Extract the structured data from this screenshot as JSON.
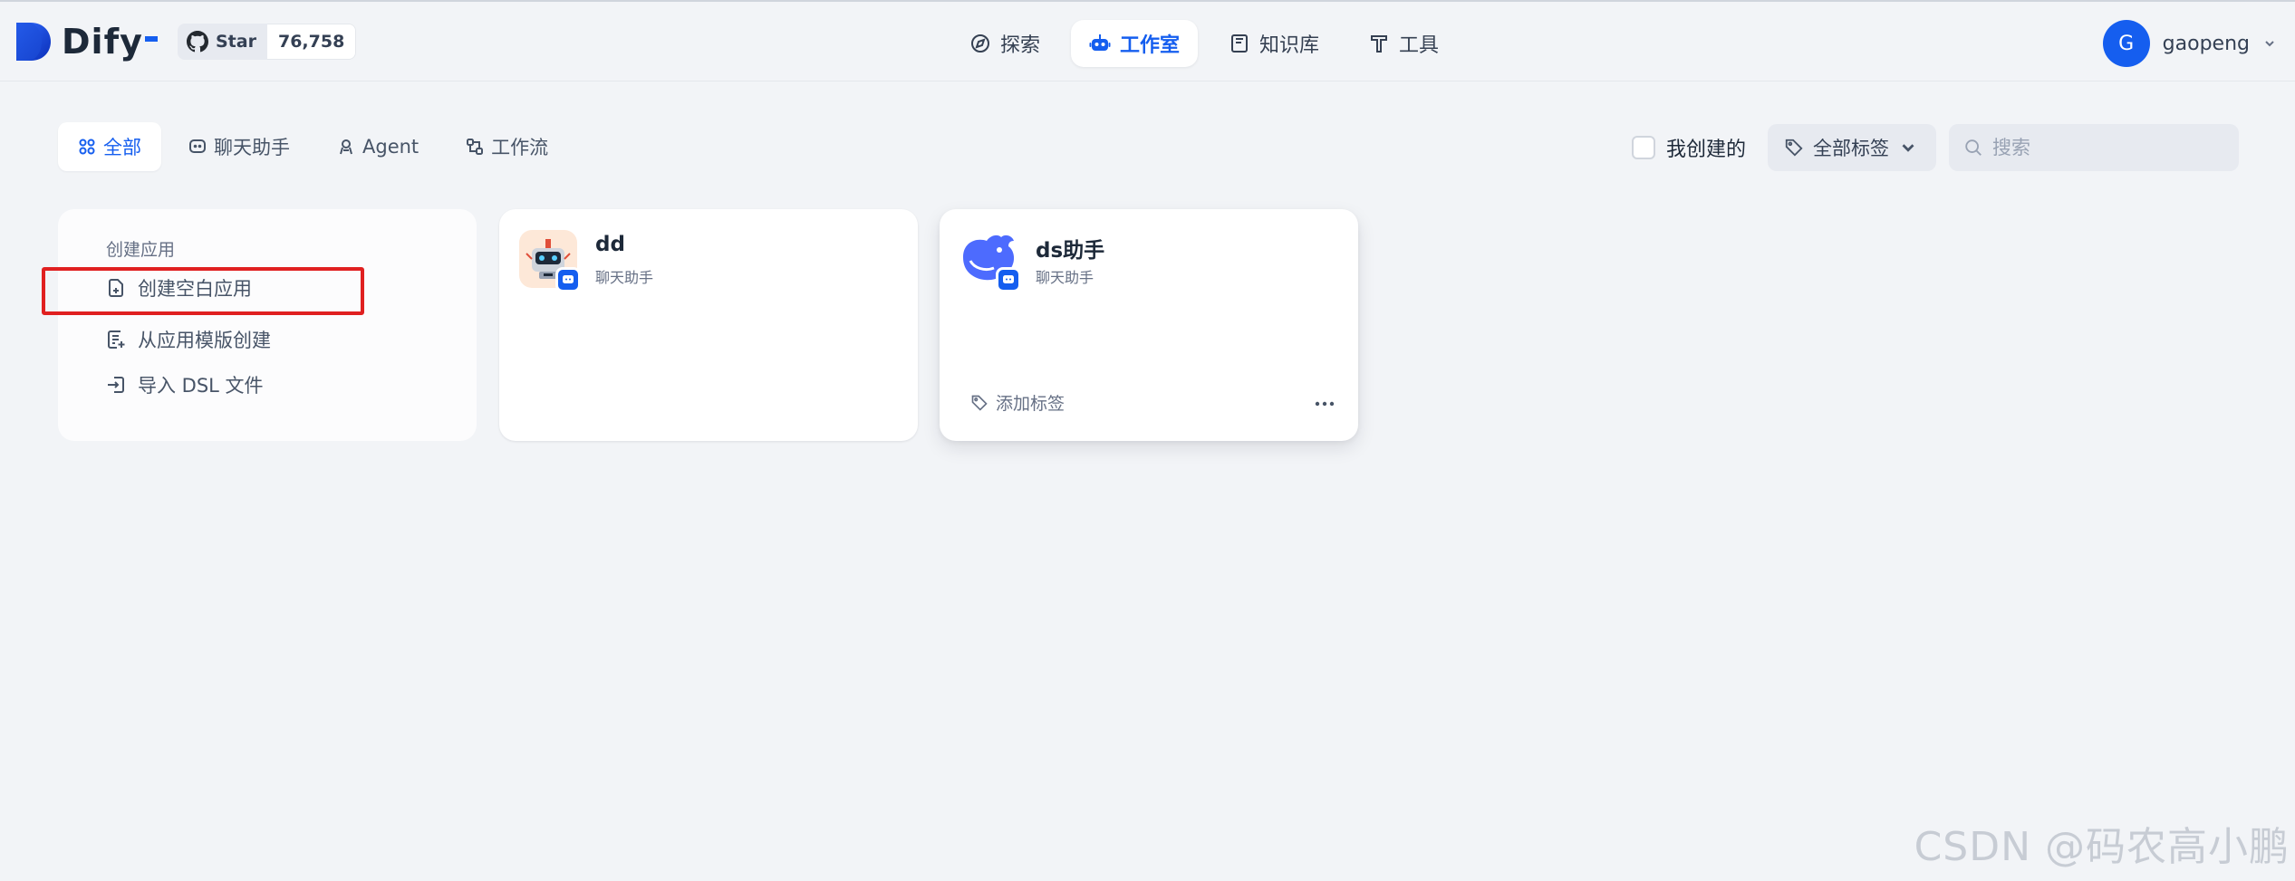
{
  "app": {
    "logo_text": "Dify"
  },
  "github": {
    "star_label": "Star",
    "star_count": "76,758"
  },
  "nav": {
    "explore": "探索",
    "studio": "工作室",
    "knowledge": "知识库",
    "tools": "工具"
  },
  "user": {
    "initial": "G",
    "name": "gaopeng"
  },
  "tabs": {
    "all": "全部",
    "chat": "聊天助手",
    "agent": "Agent",
    "workflow": "工作流"
  },
  "filters": {
    "created_by_me": "我创建的",
    "all_tags": "全部标签",
    "search_placeholder": "搜索"
  },
  "create_card": {
    "title": "创建应用",
    "blank": "创建空白应用",
    "template": "从应用模版创建",
    "import_dsl": "导入 DSL 文件"
  },
  "apps": [
    {
      "name": "dd",
      "type": "聊天助手"
    },
    {
      "name": "ds助手",
      "type": "聊天助手",
      "tag_label": "添加标签"
    }
  ],
  "watermark": "CSDN @码农高小鹏",
  "colors": {
    "accent": "#155eef",
    "highlight": "#e02020",
    "background": "#f2f4f7"
  }
}
